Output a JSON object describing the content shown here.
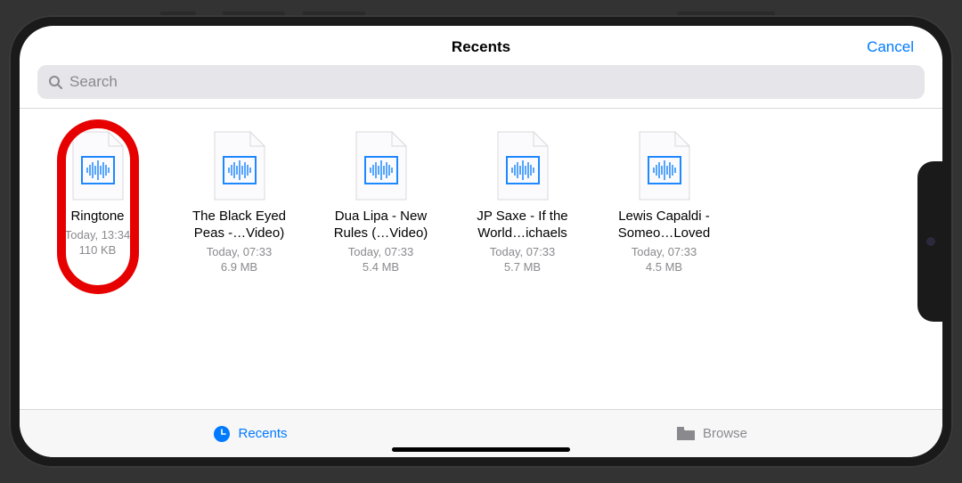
{
  "header": {
    "title": "Recents",
    "cancel_label": "Cancel"
  },
  "search": {
    "placeholder": "Search"
  },
  "files": [
    {
      "name": "Ringtone",
      "date": "Today, 13:34",
      "size": "110 KB",
      "highlighted": true
    },
    {
      "name": "The Black Eyed Peas -…Video)",
      "date": "Today, 07:33",
      "size": "6.9 MB",
      "highlighted": false
    },
    {
      "name": "Dua Lipa - New Rules (…Video)",
      "date": "Today, 07:33",
      "size": "5.4 MB",
      "highlighted": false
    },
    {
      "name": "JP Saxe - If the World…ichaels",
      "date": "Today, 07:33",
      "size": "5.7 MB",
      "highlighted": false
    },
    {
      "name": "Lewis Capaldi - Someo…Loved",
      "date": "Today, 07:33",
      "size": "4.5 MB",
      "highlighted": false
    }
  ],
  "tabbar": {
    "recents_label": "Recents",
    "browse_label": "Browse"
  }
}
